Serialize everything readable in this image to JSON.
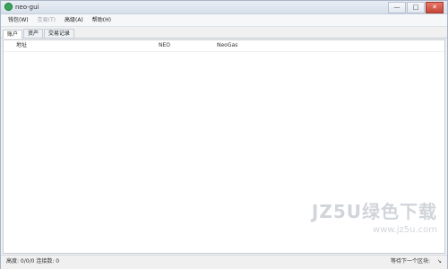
{
  "window": {
    "title": "neo-gui",
    "controls": {
      "minimize": "—",
      "maximize": "□",
      "close": "✕"
    }
  },
  "menu": [
    {
      "label": "钱包(W)",
      "enabled": true
    },
    {
      "label": "交易(T)",
      "enabled": false
    },
    {
      "label": "高级(A)",
      "enabled": true
    },
    {
      "label": "帮助(H)",
      "enabled": true
    }
  ],
  "tabs": [
    {
      "label": "账户",
      "active": true
    },
    {
      "label": "资产",
      "active": false
    },
    {
      "label": "交易记录",
      "active": false
    }
  ],
  "list": {
    "headers": [
      "地址",
      "NEO",
      "NeoGas"
    ]
  },
  "status": {
    "left": "高度: 0/0/0 连接数: 0",
    "right_text": "等待下一个区块:",
    "right_extra": "↘"
  },
  "watermark": {
    "big": "JZ5U绿色下载",
    "small": "www.jz5u.com"
  },
  "icons": {
    "app": "neo-icon"
  }
}
